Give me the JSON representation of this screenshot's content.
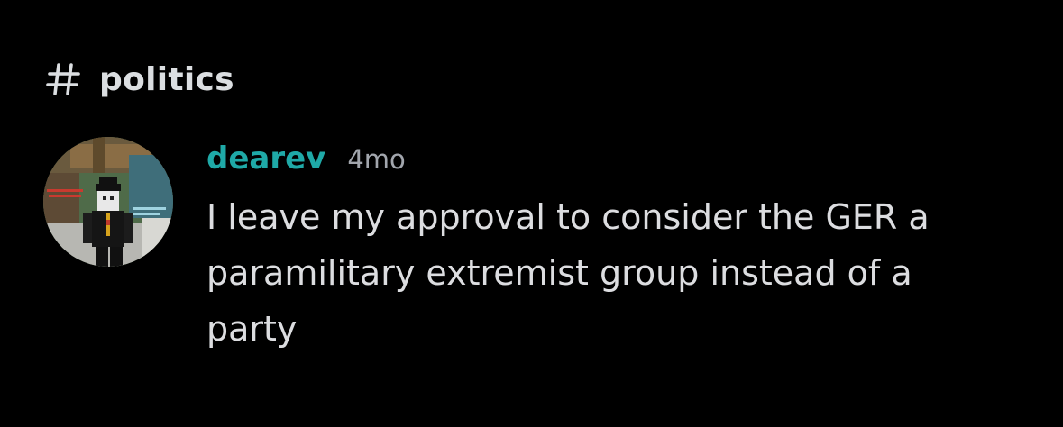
{
  "channel": {
    "icon": "hash-icon",
    "name": "politics"
  },
  "message": {
    "avatar_icon": "avatar",
    "username": "dearev",
    "username_color": "#1fa9a7",
    "timestamp": "4mo",
    "text": "I leave my approval to consider the GER a paramilitary extremist group instead of a party"
  }
}
